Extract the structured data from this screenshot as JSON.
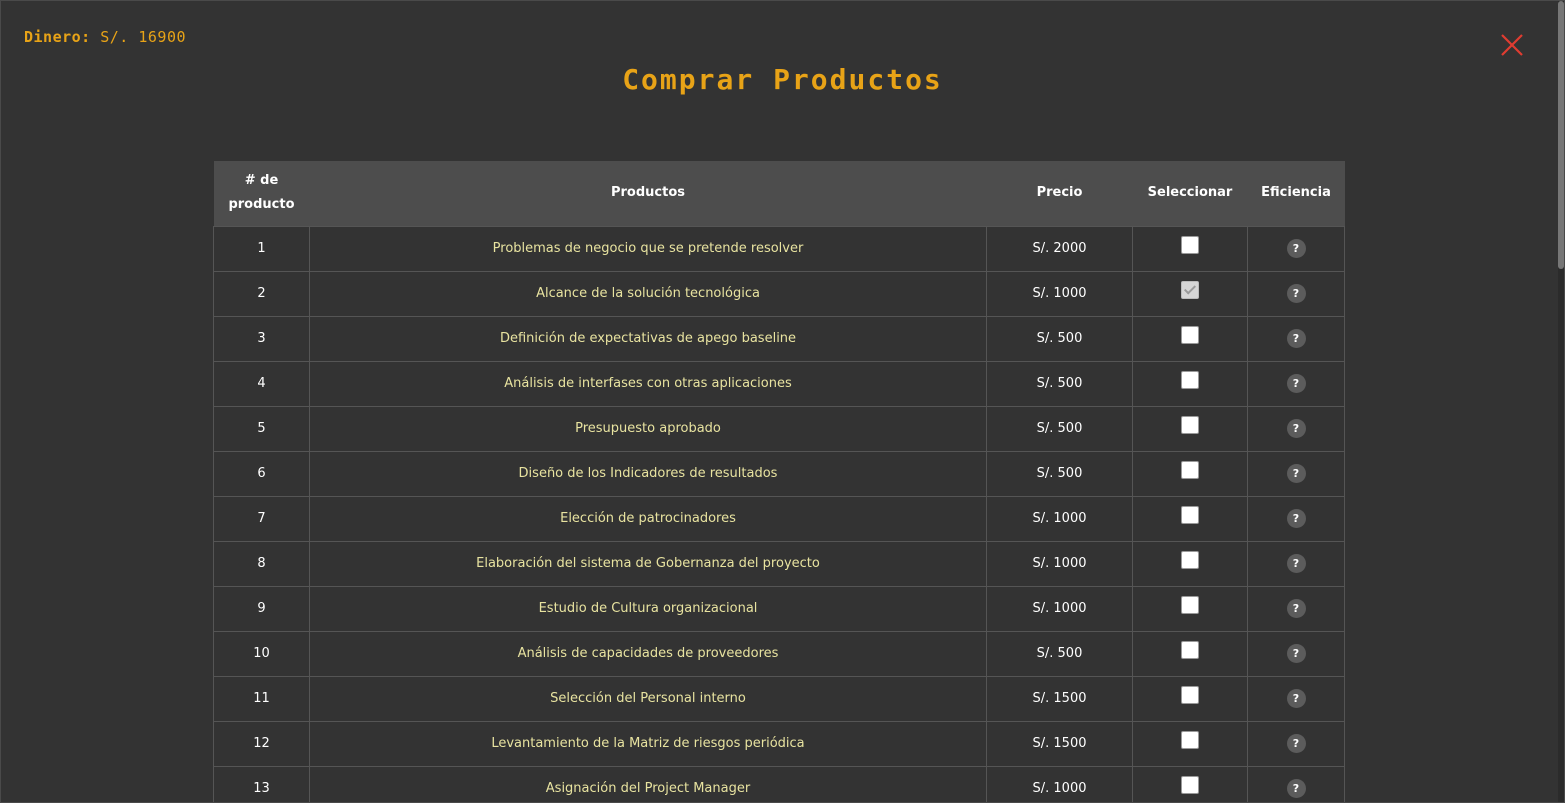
{
  "header": {
    "money_label": "Dinero:",
    "money_value": "S/. 16900",
    "title": "Comprar Productos",
    "close_icon": "close-x-icon",
    "accent_color": "#e8a317",
    "close_color": "#e03c31"
  },
  "table": {
    "columns": {
      "number_line1": "# de",
      "number_line2": "producto",
      "product": "Productos",
      "price": "Precio",
      "select": "Seleccionar",
      "efficiency": "Eficiencia"
    },
    "help_symbol": "?",
    "rows": [
      {
        "num": "1",
        "product": "Problemas de negocio que se pretende resolver",
        "price": "S/. 2000",
        "selected": false
      },
      {
        "num": "2",
        "product": "Alcance de la solución tecnológica",
        "price": "S/. 1000",
        "selected": true
      },
      {
        "num": "3",
        "product": "Definición de expectativas de apego baseline",
        "price": "S/. 500",
        "selected": false
      },
      {
        "num": "4",
        "product": "Análisis de interfases con otras aplicaciones",
        "price": "S/. 500",
        "selected": false
      },
      {
        "num": "5",
        "product": "Presupuesto aprobado",
        "price": "S/. 500",
        "selected": false
      },
      {
        "num": "6",
        "product": "Diseño de los Indicadores de resultados",
        "price": "S/. 500",
        "selected": false
      },
      {
        "num": "7",
        "product": "Elección de patrocinadores",
        "price": "S/. 1000",
        "selected": false
      },
      {
        "num": "8",
        "product": "Elaboración del sistema de Gobernanza del proyecto",
        "price": "S/. 1000",
        "selected": false
      },
      {
        "num": "9",
        "product": "Estudio de Cultura organizacional",
        "price": "S/. 1000",
        "selected": false
      },
      {
        "num": "10",
        "product": "Análisis de capacidades de proveedores",
        "price": "S/. 500",
        "selected": false
      },
      {
        "num": "11",
        "product": "Selección del Personal interno",
        "price": "S/. 1500",
        "selected": false
      },
      {
        "num": "12",
        "product": "Levantamiento de la Matriz de riesgos periódica",
        "price": "S/. 1500",
        "selected": false
      },
      {
        "num": "13",
        "product": "Asignación del Project Manager",
        "price": "S/. 1000",
        "selected": false
      }
    ]
  }
}
